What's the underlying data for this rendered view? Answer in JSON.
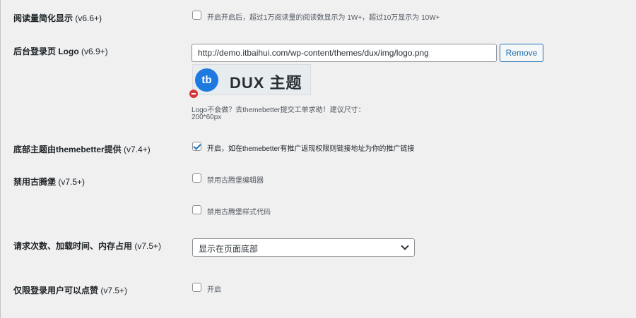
{
  "rows": {
    "readcount": {
      "label": "阅读量简化显示",
      "version": "(v6.6+)",
      "checkbox_checked": false,
      "checkbox_text": "开启开启后，超过1万阅读量的阅读数显示为 1W+，超过10万显示为 10W+"
    },
    "logo": {
      "label": "后台登录页 Logo",
      "version": "(v6.9+)",
      "input_value": "http://demo.itbaihui.com/wp-content/themes/dux/img/logo.png",
      "remove_label": "Remove",
      "preview_badge": "tb",
      "preview_text": "DUX 主题",
      "hint_line1": "Logo不会做？去themebetter提交工单求助！建议尺寸：",
      "hint_line2": "200*60px"
    },
    "footer": {
      "label": "底部主题由themebetter提供",
      "version": "(v7.4+)",
      "checkbox_checked": true,
      "checkbox_text": "开启，如在themebetter有推广返现权限则链接地址为你的推广链接"
    },
    "gutenberg": {
      "label": "禁用古腾堡",
      "version": "(v7.5+)",
      "options": [
        {
          "text": "禁用古腾堡编辑器",
          "checked": false
        },
        {
          "text": "禁用古腾堡样式代码",
          "checked": false
        }
      ]
    },
    "stats": {
      "label": "请求次数、加载时间、内存占用",
      "version": "(v7.5+)",
      "select_value": "显示在页面底部"
    },
    "likes": {
      "label": "仅限登录用户可以点赞",
      "version": "(v7.5+)",
      "checkbox_checked": false,
      "checkbox_text": "开启"
    }
  }
}
